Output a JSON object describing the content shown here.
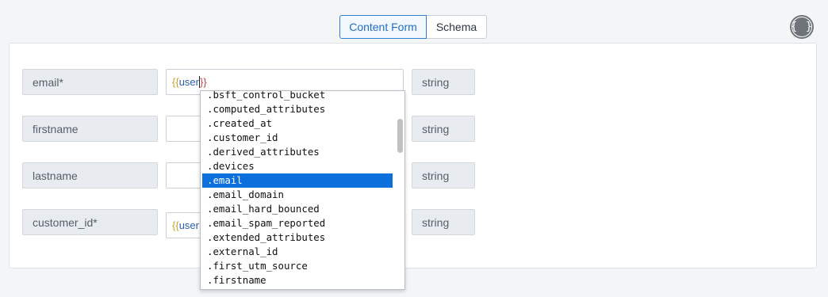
{
  "tabs": {
    "content_form": "Content Form",
    "schema": "Schema"
  },
  "code_button": "{ }",
  "rows": [
    {
      "key": "email*",
      "value_open": "{{",
      "value_var": "user",
      "value_close": "}}",
      "type": "string"
    },
    {
      "key": "firstname",
      "value": "",
      "type": "string"
    },
    {
      "key": "lastname",
      "value": "",
      "type": "string"
    },
    {
      "key": "customer_id*",
      "value_open": "{{",
      "value_var": "user",
      "type": "string"
    }
  ],
  "autocomplete": {
    "items": [
      ".bsft_control_bucket",
      ".computed_attributes",
      ".created_at",
      ".customer_id",
      ".derived_attributes",
      ".devices",
      ".email",
      ".email_domain",
      ".email_hard_bounced",
      ".email_spam_reported",
      ".extended_attributes",
      ".external_id",
      ".first_utm_source",
      ".firstname"
    ],
    "selected": ".email"
  },
  "colors": {
    "accent": "#2f7fd1",
    "selected": "#0b6fdc"
  }
}
